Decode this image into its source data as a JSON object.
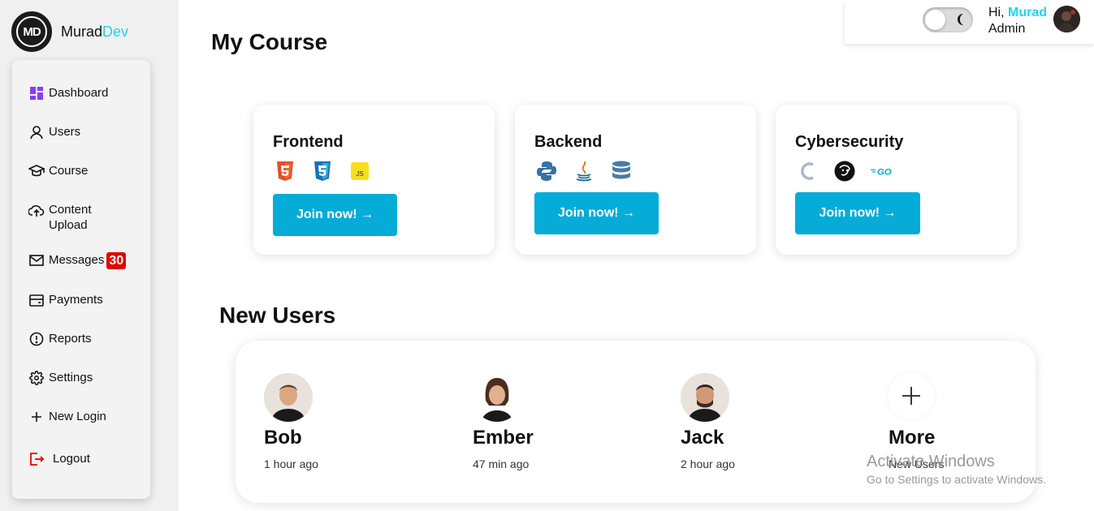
{
  "brand": {
    "logo_text": "MD",
    "name": "Murad",
    "name_accent": "Dev"
  },
  "sidebar": {
    "items": [
      {
        "label": "Dashboard",
        "icon": "dashboard-icon"
      },
      {
        "label": "Users",
        "icon": "user-icon"
      },
      {
        "label": "Course",
        "icon": "graduation-cap-icon"
      },
      {
        "label": "Content Upload",
        "icon": "cloud-upload-icon"
      },
      {
        "label": "Messages",
        "icon": "mail-icon",
        "badge": "30"
      },
      {
        "label": "Payments",
        "icon": "wallet-icon"
      },
      {
        "label": "Reports",
        "icon": "alert-circle-icon"
      },
      {
        "label": "Settings",
        "icon": "gear-icon"
      },
      {
        "label": "New Login",
        "icon": "plus-icon"
      },
      {
        "label": "Logout",
        "icon": "logout-icon"
      }
    ]
  },
  "header": {
    "greeting": "Hi,",
    "user_name": "Murad",
    "role": "Admin",
    "theme_toggle": "off"
  },
  "courses": {
    "title": "My Course",
    "cards": [
      {
        "title": "Frontend",
        "button": "Join now! →",
        "icons": [
          "html5-icon",
          "css3-icon",
          "javascript-icon"
        ]
      },
      {
        "title": "Backend",
        "button": "Join now! →",
        "icons": [
          "python-icon",
          "java-icon",
          "database-icon"
        ]
      },
      {
        "title": "Cybersecurity",
        "button": "Join now! →",
        "icons": [
          "c-language-icon",
          "hacker-icon",
          "go-language-icon"
        ]
      }
    ]
  },
  "new_users": {
    "title": "New Users",
    "users": [
      {
        "name": "Bob",
        "time": "1 hour ago"
      },
      {
        "name": "Ember",
        "time": "47 min ago"
      },
      {
        "name": "Jack",
        "time": "2 hour ago"
      }
    ],
    "more": {
      "label": "More",
      "sub": "New Users"
    }
  },
  "watermark": {
    "title": "Activate Windows",
    "subtitle": "Go to Settings to activate Windows."
  },
  "colors": {
    "accent": "#05acd8",
    "brand_accent": "#22d3ee",
    "badge": "#e10600"
  }
}
